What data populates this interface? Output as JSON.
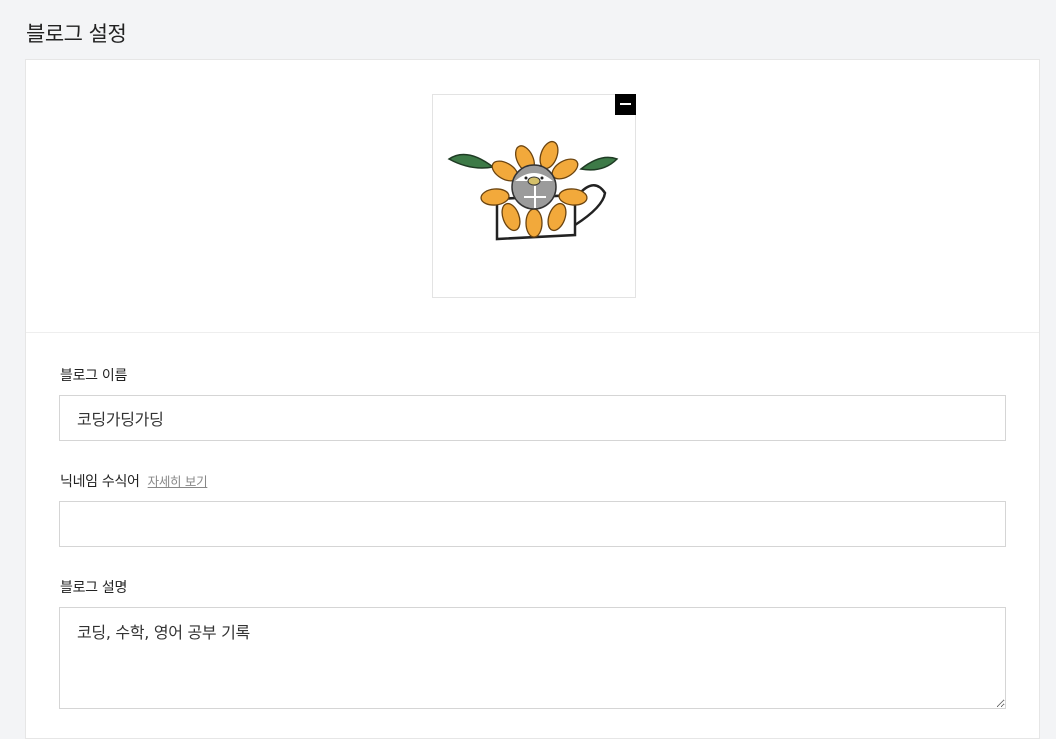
{
  "page": {
    "title": "블로그 설정"
  },
  "profile_image": {
    "icon": "sunflower-watering-can-image",
    "accent_colors": [
      "#f2a93b",
      "#3d7a47",
      "#9b9b9b"
    ]
  },
  "form": {
    "blog_name": {
      "label": "블로그 이름",
      "value": "코딩가딩가딩"
    },
    "nickname_modifier": {
      "label": "닉네임 수식어",
      "help_link": "자세히 보기",
      "value": ""
    },
    "blog_description": {
      "label": "블로그 설명",
      "value": "코딩, 수학, 영어 공부 기록"
    }
  }
}
